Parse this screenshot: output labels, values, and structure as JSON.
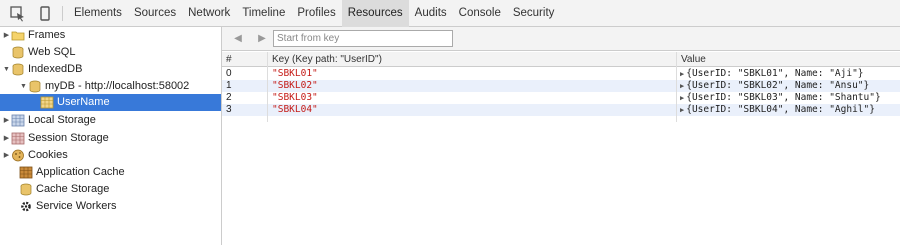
{
  "toolbar": {
    "tabs": [
      "Elements",
      "Sources",
      "Network",
      "Timeline",
      "Profiles",
      "Resources",
      "Audits",
      "Console",
      "Security"
    ],
    "active_tab": "Resources"
  },
  "sidebar": {
    "frames": "Frames",
    "websql": "Web SQL",
    "indexeddb": "IndexedDB",
    "mydb": "myDB - http://localhost:58002",
    "username": "UserName",
    "local_storage": "Local Storage",
    "session_storage": "Session Storage",
    "cookies": "Cookies",
    "app_cache": "Application Cache",
    "cache_storage": "Cache Storage",
    "service_workers": "Service Workers"
  },
  "content": {
    "start_placeholder": "Start from key",
    "columns": {
      "num": "#",
      "key": "Key (Key path: \"UserID\")",
      "value": "Value"
    },
    "rows": [
      {
        "num": "0",
        "key": "\"SBKL01\"",
        "value": "{UserID: \"SBKL01\", Name: \"Aji\"}"
      },
      {
        "num": "1",
        "key": "\"SBKL02\"",
        "value": "{UserID: \"SBKL02\", Name: \"Ansu\"}"
      },
      {
        "num": "2",
        "key": "\"SBKL03\"",
        "value": "{UserID: \"SBKL03\", Name: \"Shantu\"}"
      },
      {
        "num": "3",
        "key": "\"SBKL04\"",
        "value": "{UserID: \"SBKL04\", Name: \"Aghil\"}"
      }
    ]
  },
  "colors": {
    "selection": "#3879d9",
    "key_string": "#c41a16",
    "alt_row": "#eaf0fb"
  }
}
